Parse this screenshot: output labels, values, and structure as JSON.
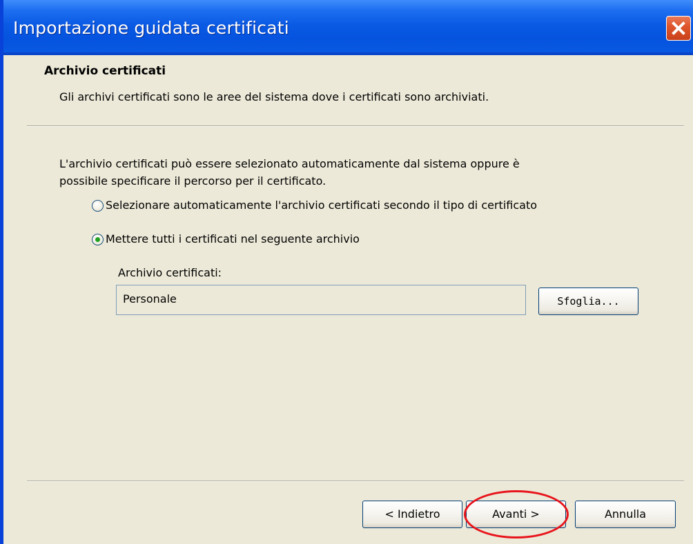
{
  "window": {
    "title": "Importazione guidata certificati",
    "close_icon": "close-icon"
  },
  "header": {
    "title": "Archivio certificati",
    "description": "Gli archivi certificati sono le aree del sistema dove i certificati sono archiviati."
  },
  "body": {
    "intro_line_1": "L'archivio certificati può essere selezionato automaticamente dal sistema oppure è",
    "intro_line_2": "possibile specificare il percorso per il certificato.",
    "options": [
      {
        "label": "Selezionare automaticamente l'archivio certificati secondo il tipo di certificato",
        "selected": false
      },
      {
        "label": "Mettere tutti i certificati nel seguente archivio",
        "selected": true
      }
    ],
    "store_label": "Archivio certificati:",
    "store_value": "Personale",
    "browse_label": "Sfoglia..."
  },
  "footer": {
    "back_label": "< Indietro",
    "next_label": "Avanti >",
    "cancel_label": "Annulla"
  },
  "colors": {
    "titlebar": "#0a5ae4",
    "dialog_bg": "#ece9d8",
    "highlight": "#e8141c",
    "radio_selected": "#21a121"
  }
}
